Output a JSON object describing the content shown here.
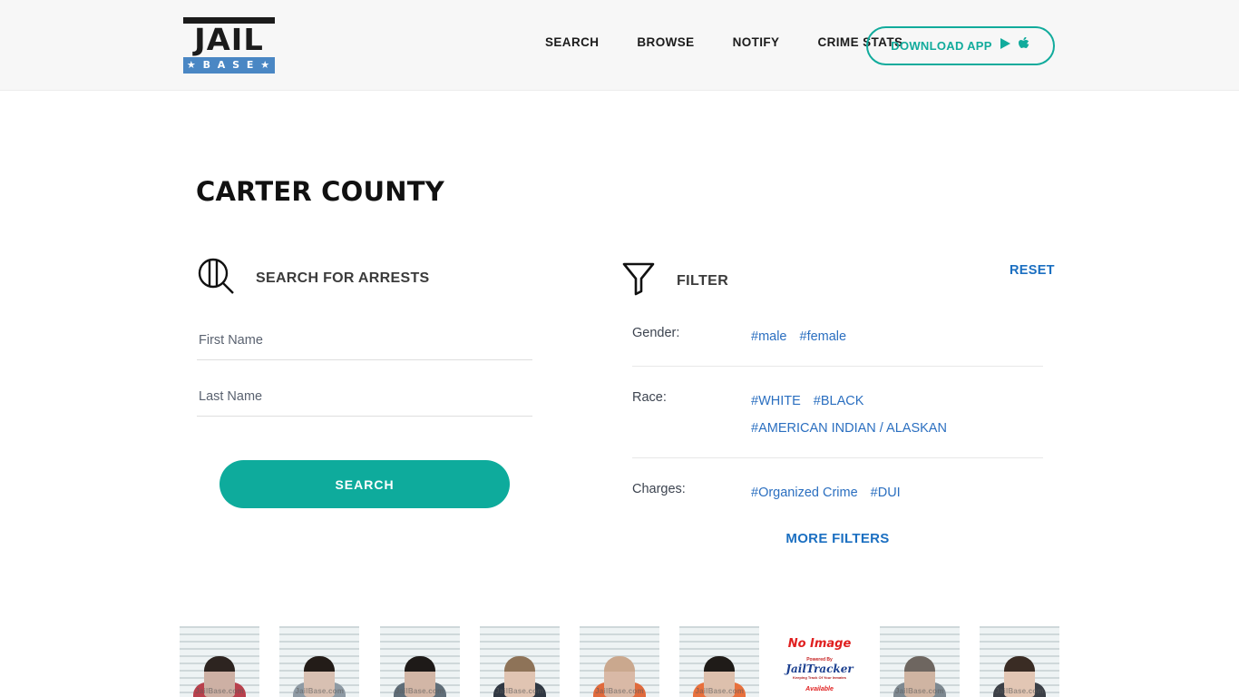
{
  "header": {
    "logo": {
      "top_text": "JAIL",
      "bottom_text": "★ B A S E ★"
    },
    "nav": [
      {
        "label": "SEARCH"
      },
      {
        "label": "BROWSE"
      },
      {
        "label": "NOTIFY"
      },
      {
        "label": "CRIME STATS"
      }
    ],
    "download_button": {
      "label": "DOWNLOAD APP",
      "icons": [
        "google-play-icon",
        "apple-icon"
      ],
      "accent_color": "#11ab9c"
    }
  },
  "page": {
    "title": "CARTER COUNTY"
  },
  "search_panel": {
    "heading": "SEARCH FOR ARRESTS",
    "heading_icon": "jail-magnifier-icon",
    "first_name_placeholder": "First Name",
    "first_name_value": "",
    "last_name_placeholder": "Last Name",
    "last_name_value": "",
    "search_button_label": "SEARCH",
    "search_button_color": "#0eab9c"
  },
  "filter_panel": {
    "heading": "FILTER",
    "heading_icon": "funnel-icon",
    "reset_label": "RESET",
    "link_color": "#1b6fc1",
    "rows": [
      {
        "label": "Gender:",
        "tags": [
          "#male",
          "#female"
        ]
      },
      {
        "label": "Race:",
        "tags": [
          "#WHITE",
          "#BLACK",
          "#AMERICAN INDIAN / ALASKAN"
        ]
      },
      {
        "label": "Charges:",
        "tags": [
          "#Organized Crime",
          "#DUI"
        ]
      }
    ],
    "more_filters_label": "MORE FILTERS"
  },
  "mugshots": {
    "watermark": "JailBase.com",
    "no_image": {
      "title": "No Image",
      "powered_by": "Powered By",
      "brand": "JailTracker",
      "tagline": "Keeping Track Of Your Inmates",
      "availability": "Available"
    },
    "items": [
      {
        "skin": "#cdb0a4",
        "hair": "#2d2420",
        "shirt": "#b8404c",
        "has_image": true
      },
      {
        "skin": "#d8c0b2",
        "hair": "#231c18",
        "shirt": "#8e9aa4",
        "has_image": true
      },
      {
        "skin": "#d2b6a6",
        "hair": "#1e1a18",
        "shirt": "#5f6d78",
        "has_image": true
      },
      {
        "skin": "#e0c4b2",
        "hair": "#8e7358",
        "shirt": "#2f3742",
        "has_image": true
      },
      {
        "skin": "#d9b9a6",
        "hair": "#caa88e",
        "shirt": "#e06a3c",
        "has_image": true
      },
      {
        "skin": "#ddc0ad",
        "hair": "#1f1b18",
        "shirt": "#e8703c",
        "has_image": true
      },
      {
        "skin": "",
        "hair": "",
        "shirt": "",
        "has_image": false
      },
      {
        "skin": "#cfb4a2",
        "hair": "#6e6660",
        "shirt": "#7d8890",
        "has_image": true
      },
      {
        "skin": "#e2c6b4",
        "hair": "#3a2c24",
        "shirt": "#3b3f46",
        "has_image": true
      }
    ]
  }
}
